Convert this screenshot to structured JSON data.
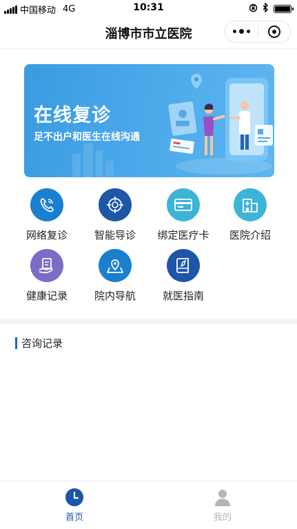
{
  "status_bar": {
    "carrier": "中国移动",
    "network": "4G",
    "time": "10:31"
  },
  "header": {
    "title": "淄博市市立医院",
    "more_icon": "more-dots-icon",
    "close_icon": "target-circle-icon"
  },
  "banner": {
    "title": "在线复诊",
    "subtitle": "足不出户和医生在线沟通"
  },
  "menu": {
    "items": [
      {
        "label": "网络复诊",
        "icon": "phone-icon",
        "color": "#1a7fcf"
      },
      {
        "label": "智能导诊",
        "icon": "crosshair-icon",
        "color": "#1e56a8"
      },
      {
        "label": "绑定医疗卡",
        "icon": "card-icon",
        "color": "#3cb4d6"
      },
      {
        "label": "医院介绍",
        "icon": "hospital-icon",
        "color": "#3cb4d6"
      },
      {
        "label": "健康记录",
        "icon": "record-hand-icon",
        "color": "#7b6cc8"
      },
      {
        "label": "院内导航",
        "icon": "map-pin-icon",
        "color": "#1a7fcf"
      },
      {
        "label": "就医指南",
        "icon": "guide-book-icon",
        "color": "#1e56a8"
      }
    ]
  },
  "records": {
    "title": "咨询记录"
  },
  "tabbar": {
    "tabs": [
      {
        "label": "首页",
        "icon": "clock-icon",
        "active": true,
        "color": "#1a56a8"
      },
      {
        "label": "我的",
        "icon": "person-icon",
        "active": false,
        "color": "#b5b5b5"
      }
    ]
  },
  "colors": {
    "accent": "#1a56a8",
    "banner": "#3a9be0",
    "section_bar": "#1a67c4"
  }
}
